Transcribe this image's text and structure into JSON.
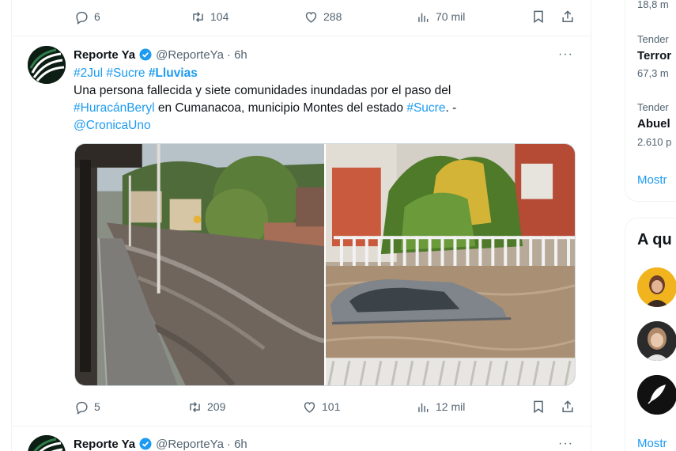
{
  "tweet_prev": {
    "replies": "6",
    "retweets": "104",
    "likes": "288",
    "views": "70 mil"
  },
  "tweet_main": {
    "name": "Reporte Ya",
    "handle": "@ReporteYa",
    "time": "· 6h",
    "more": "···",
    "tags_line": [
      "#2Jul",
      "#Sucre",
      "#Lluvias"
    ],
    "text_1": "Una persona fallecida y siete  comunidades inundadas por el paso del",
    "tag_huracan": "#HuracánBeryl",
    "text_2": " en Cumanacoa, municipio Montes del estado ",
    "tag_sucre2": "#Sucre",
    "text_3": ". -",
    "mention": "@CronicaUno",
    "replies": "5",
    "retweets": "209",
    "likes": "101",
    "views": "12 mil"
  },
  "tweet_next": {
    "name": "Reporte Ya",
    "handle": "@ReporteYa",
    "time": "· 6h",
    "more": "···"
  },
  "sidebar": {
    "trend1_count": "18,8 m",
    "trend2_label": "Tender",
    "trend2_title": "Terror",
    "trend2_count": "67,3 m",
    "trend3_label": "Tender",
    "trend3_title": "Abuel",
    "trend3_count": "2.610 p",
    "show_more_1": "Mostr",
    "who_to_follow_heading": "A qu",
    "show_more_2": "Mostr"
  },
  "colors": {
    "accent": "#1d9bf0",
    "muted": "#536471",
    "border": "#eff3f4"
  }
}
